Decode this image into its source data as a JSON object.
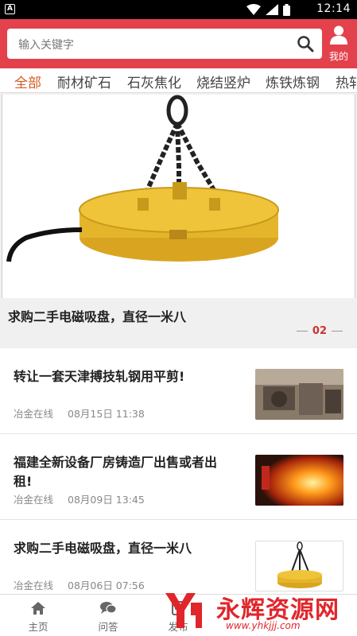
{
  "status_bar": {
    "app_badge": "A",
    "time": "12:14"
  },
  "search": {
    "placeholder": "输入关键字"
  },
  "header": {
    "mine_label": "我的"
  },
  "category_tabs": [
    "全部",
    "耐材矿石",
    "石灰焦化",
    "烧结竖炉",
    "炼铁炼钢",
    "热轧"
  ],
  "banner": {
    "title": "求购二手电磁吸盘，直径一米八",
    "page_indicator": "02"
  },
  "news": [
    {
      "title": "转让一套天津搏技轧钢用平剪!",
      "source": "冶金在线",
      "time": "08月15日 11:38",
      "thumb": "machine"
    },
    {
      "title": "福建全新设备厂房铸造厂出售或者出租!",
      "source": "冶金在线",
      "time": "08月09日 13:45",
      "thumb": "foundry"
    },
    {
      "title": "求购二手电磁吸盘，直径一米八",
      "source": "冶金在线",
      "time": "08月06日 07:56",
      "thumb": "magnet"
    }
  ],
  "bottom_nav": [
    {
      "label": "主页",
      "icon": "home-icon"
    },
    {
      "label": "问答",
      "icon": "chat-icon"
    },
    {
      "label": "发布",
      "icon": "publish-icon"
    }
  ],
  "watermark": {
    "text": "永辉资源网",
    "url": "www.yhkjjj.com"
  },
  "colors": {
    "header_red": "#e3414c",
    "active_tab": "#d65b22",
    "pager_red": "#cc3333"
  }
}
